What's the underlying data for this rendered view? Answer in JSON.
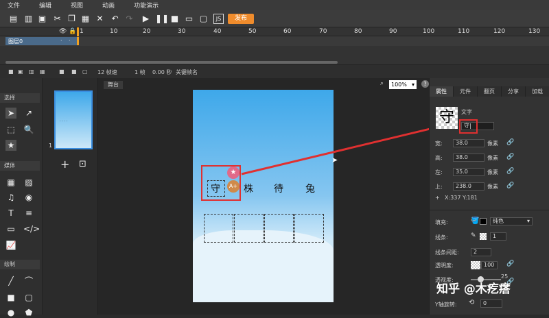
{
  "menu": [
    "文件",
    "编辑",
    "视图",
    "动画",
    "功能演示"
  ],
  "toolbar": {
    "publish_label": "发布"
  },
  "ruler": {
    "ticks": [
      "1",
      "10",
      "20",
      "30",
      "40",
      "50",
      "60",
      "70",
      "80",
      "90",
      "100",
      "110",
      "120",
      "130"
    ]
  },
  "layer": {
    "name": "图层0"
  },
  "timeline_status": {
    "fps": "12 帧速",
    "frame": "1 帧",
    "time": "0.00 秒",
    "keyframe_label": "关键帧名"
  },
  "left_panel": {
    "select_label": "选择",
    "media_label": "媒体",
    "draw_label": "绘制"
  },
  "thumb": {
    "index": "1"
  },
  "stage": {
    "tab_label": "舞台",
    "zoom": "100%"
  },
  "page": {
    "chars": [
      "守",
      "株",
      "待",
      "兔"
    ]
  },
  "right_panel": {
    "tabs": [
      "属性",
      "元件",
      "翻页",
      "分享",
      "加载"
    ],
    "type_label": "文字",
    "text_value": "守|",
    "width_label": "宽:",
    "width_value": "38.0",
    "height_label": "高:",
    "height_value": "38.0",
    "left_label": "左:",
    "left_value": "35.0",
    "top_label": "上:",
    "top_value": "238.0",
    "unit": "像素",
    "coords": "X:337    Y:181",
    "fill_label": "填充:",
    "fill_type": "纯色",
    "line_label": "线条:",
    "line_value": "1",
    "line_spacing_label": "线条间距:",
    "line_spacing_value": "2",
    "opacity_label": "透明度:",
    "opacity_value": "100",
    "transparency_label": "透视度:",
    "transparency_value": "25",
    "yrot_label": "Y轴旋转:",
    "yrot_value": "0"
  },
  "watermark": "知乎 @木疙瘩"
}
